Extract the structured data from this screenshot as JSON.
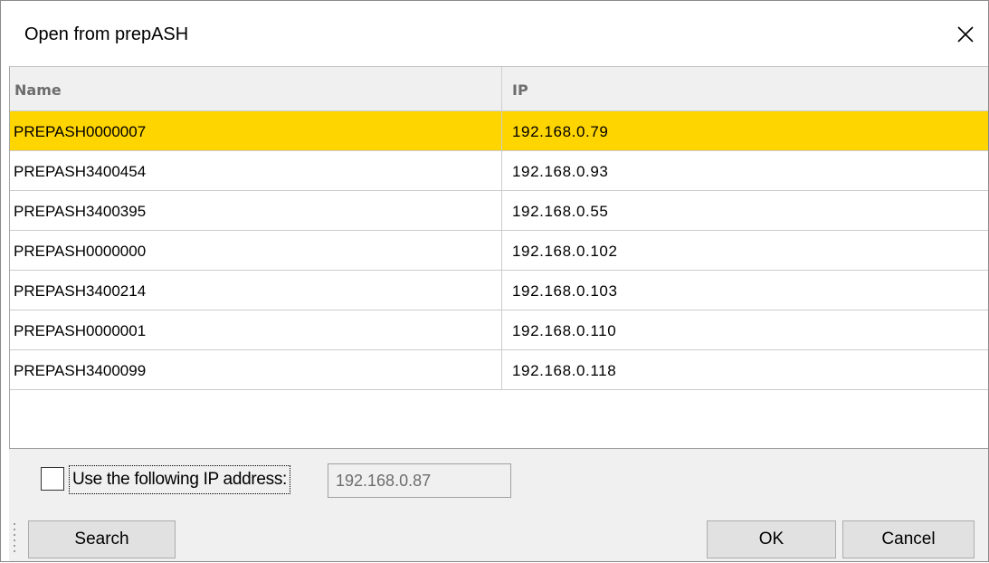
{
  "window": {
    "title": "Open from prepASH",
    "close_icon": "close-icon"
  },
  "table": {
    "columns": [
      "Name",
      "IP"
    ],
    "rows": [
      {
        "name": "PREPASH0000007",
        "ip": "192.168.0.79",
        "selected": true
      },
      {
        "name": "PREPASH3400454",
        "ip": "192.168.0.93",
        "selected": false
      },
      {
        "name": "PREPASH3400395",
        "ip": "192.168.0.55",
        "selected": false
      },
      {
        "name": "PREPASH0000000",
        "ip": "192.168.0.102",
        "selected": false
      },
      {
        "name": "PREPASH3400214",
        "ip": "192.168.0.103",
        "selected": false
      },
      {
        "name": "PREPASH0000001",
        "ip": "192.168.0.110",
        "selected": false
      },
      {
        "name": "PREPASH3400099",
        "ip": "192.168.0.118",
        "selected": false
      }
    ],
    "selection_color": "#ffd500"
  },
  "ip_option": {
    "checkbox_label": "Use the following IP address:",
    "checked": false,
    "value": "192.168.0.87"
  },
  "buttons": {
    "search": "Search",
    "ok": "OK",
    "cancel": "Cancel"
  }
}
